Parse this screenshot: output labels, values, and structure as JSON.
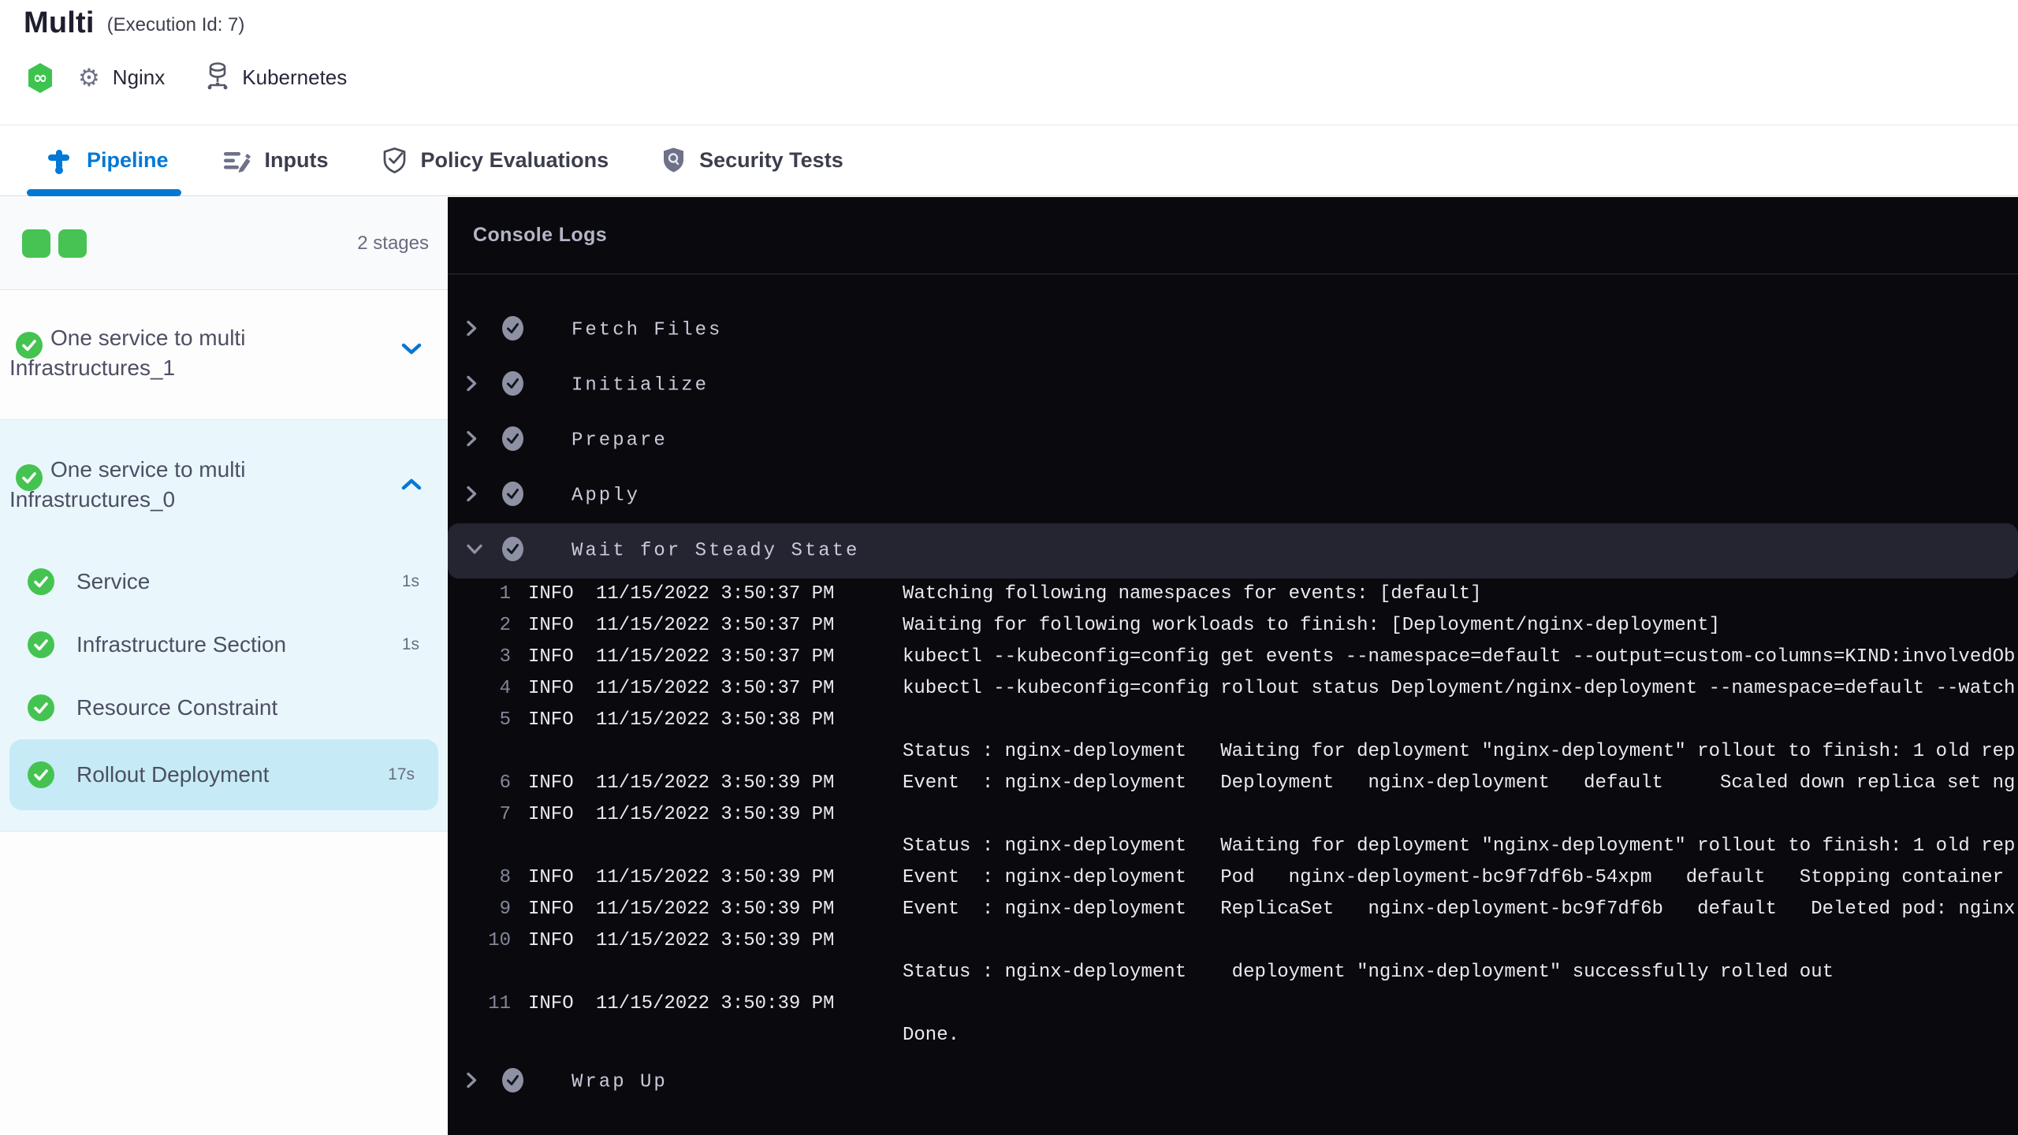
{
  "header": {
    "title": "Multi",
    "execution_id": "(Execution Id: 7)",
    "service_label": "Nginx",
    "infra_label": "Kubernetes"
  },
  "tabs": [
    {
      "label": "Pipeline",
      "active": true
    },
    {
      "label": "Inputs",
      "active": false
    },
    {
      "label": "Policy Evaluations",
      "active": false
    },
    {
      "label": "Security Tests",
      "active": false
    }
  ],
  "sidebar": {
    "stages_count": "2 stages",
    "stage1": {
      "label": "One service to multi Infrastructures_1",
      "status": "success",
      "expanded": false
    },
    "stage2": {
      "label": "One service to multi Infrastructures_0",
      "status": "success",
      "expanded": true,
      "steps": [
        {
          "label": "Service",
          "duration": "1s",
          "state": ""
        },
        {
          "label": "Infrastructure Section",
          "duration": "1s",
          "state": ""
        },
        {
          "label": "Resource Constraint",
          "duration": "",
          "state": ""
        },
        {
          "label": "Rollout Deployment",
          "duration": "17s",
          "state": "selected"
        }
      ]
    }
  },
  "console": {
    "title": "Console Logs",
    "steps_before": [
      {
        "label": "Fetch Files"
      },
      {
        "label": "Initialize"
      },
      {
        "label": "Prepare"
      },
      {
        "label": "Apply"
      }
    ],
    "active_step": {
      "label": "Wait for Steady State"
    },
    "final_step": {
      "label": "Wrap Up"
    },
    "logs": [
      {
        "num": "1",
        "level": "INFO",
        "ts": "11/15/2022 3:50:37 PM",
        "msg": "Watching following namespaces for events: [default]"
      },
      {
        "num": "2",
        "level": "INFO",
        "ts": "11/15/2022 3:50:37 PM",
        "msg": "Waiting for following workloads to finish: [Deployment/nginx-deployment]"
      },
      {
        "num": "3",
        "level": "INFO",
        "ts": "11/15/2022 3:50:37 PM",
        "msg": "kubectl --kubeconfig=config get events --namespace=default --output=custom-columns=KIND:involvedOb"
      },
      {
        "num": "4",
        "level": "INFO",
        "ts": "11/15/2022 3:50:37 PM",
        "msg": "kubectl --kubeconfig=config rollout status Deployment/nginx-deployment --namespace=default --watch"
      },
      {
        "num": "5",
        "level": "INFO",
        "ts": "11/15/2022 3:50:38 PM",
        "msg": ""
      },
      {
        "num": "",
        "level": "",
        "ts": "",
        "msg": "Status : nginx-deployment   Waiting for deployment \"nginx-deployment\" rollout to finish: 1 old rep"
      },
      {
        "num": "6",
        "level": "INFO",
        "ts": "11/15/2022 3:50:39 PM",
        "msg": "Event  : nginx-deployment   Deployment   nginx-deployment   default     Scaled down replica set ng"
      },
      {
        "num": "7",
        "level": "INFO",
        "ts": "11/15/2022 3:50:39 PM",
        "msg": ""
      },
      {
        "num": "",
        "level": "",
        "ts": "",
        "msg": "Status : nginx-deployment   Waiting for deployment \"nginx-deployment\" rollout to finish: 1 old rep"
      },
      {
        "num": "8",
        "level": "INFO",
        "ts": "11/15/2022 3:50:39 PM",
        "msg": "Event  : nginx-deployment   Pod   nginx-deployment-bc9f7df6b-54xpm   default   Stopping container"
      },
      {
        "num": "9",
        "level": "INFO",
        "ts": "11/15/2022 3:50:39 PM",
        "msg": "Event  : nginx-deployment   ReplicaSet   nginx-deployment-bc9f7df6b   default   Deleted pod: nginx"
      },
      {
        "num": "10",
        "level": "INFO",
        "ts": "11/15/2022 3:50:39 PM",
        "msg": ""
      },
      {
        "num": "",
        "level": "",
        "ts": "",
        "msg": "Status : nginx-deployment    deployment \"nginx-deployment\" successfully rolled out"
      },
      {
        "num": "11",
        "level": "INFO",
        "ts": "11/15/2022 3:50:39 PM",
        "msg": ""
      },
      {
        "num": "",
        "level": "",
        "ts": "",
        "msg": "Done."
      }
    ]
  },
  "colors": {
    "accent_blue": "#0278d5",
    "success_green": "#45c351",
    "selected_step_bg": "#c6ebf6",
    "expanded_stage_bg": "#e9f7fc",
    "console_bg": "#0a0a0e",
    "console_highlight": "#242531"
  }
}
